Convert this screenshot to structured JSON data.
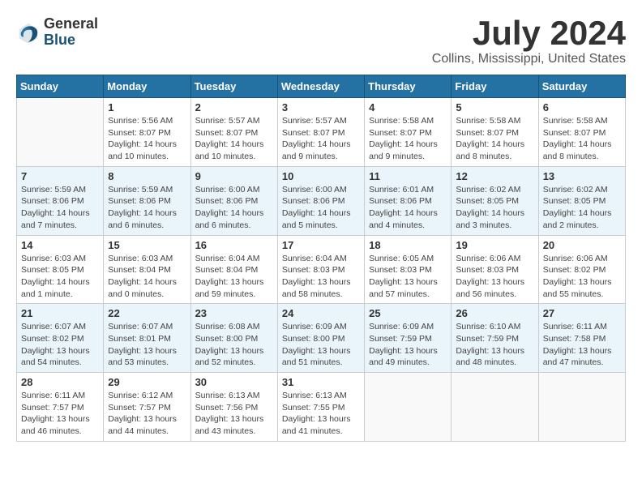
{
  "logo": {
    "general": "General",
    "blue": "Blue"
  },
  "title": "July 2024",
  "location": "Collins, Mississippi, United States",
  "days_of_week": [
    "Sunday",
    "Monday",
    "Tuesday",
    "Wednesday",
    "Thursday",
    "Friday",
    "Saturday"
  ],
  "weeks": [
    [
      {
        "day": "",
        "info": ""
      },
      {
        "day": "1",
        "info": "Sunrise: 5:56 AM\nSunset: 8:07 PM\nDaylight: 14 hours\nand 10 minutes."
      },
      {
        "day": "2",
        "info": "Sunrise: 5:57 AM\nSunset: 8:07 PM\nDaylight: 14 hours\nand 10 minutes."
      },
      {
        "day": "3",
        "info": "Sunrise: 5:57 AM\nSunset: 8:07 PM\nDaylight: 14 hours\nand 9 minutes."
      },
      {
        "day": "4",
        "info": "Sunrise: 5:58 AM\nSunset: 8:07 PM\nDaylight: 14 hours\nand 9 minutes."
      },
      {
        "day": "5",
        "info": "Sunrise: 5:58 AM\nSunset: 8:07 PM\nDaylight: 14 hours\nand 8 minutes."
      },
      {
        "day": "6",
        "info": "Sunrise: 5:58 AM\nSunset: 8:07 PM\nDaylight: 14 hours\nand 8 minutes."
      }
    ],
    [
      {
        "day": "7",
        "info": "Sunrise: 5:59 AM\nSunset: 8:06 PM\nDaylight: 14 hours\nand 7 minutes."
      },
      {
        "day": "8",
        "info": "Sunrise: 5:59 AM\nSunset: 8:06 PM\nDaylight: 14 hours\nand 6 minutes."
      },
      {
        "day": "9",
        "info": "Sunrise: 6:00 AM\nSunset: 8:06 PM\nDaylight: 14 hours\nand 6 minutes."
      },
      {
        "day": "10",
        "info": "Sunrise: 6:00 AM\nSunset: 8:06 PM\nDaylight: 14 hours\nand 5 minutes."
      },
      {
        "day": "11",
        "info": "Sunrise: 6:01 AM\nSunset: 8:06 PM\nDaylight: 14 hours\nand 4 minutes."
      },
      {
        "day": "12",
        "info": "Sunrise: 6:02 AM\nSunset: 8:05 PM\nDaylight: 14 hours\nand 3 minutes."
      },
      {
        "day": "13",
        "info": "Sunrise: 6:02 AM\nSunset: 8:05 PM\nDaylight: 14 hours\nand 2 minutes."
      }
    ],
    [
      {
        "day": "14",
        "info": "Sunrise: 6:03 AM\nSunset: 8:05 PM\nDaylight: 14 hours\nand 1 minute."
      },
      {
        "day": "15",
        "info": "Sunrise: 6:03 AM\nSunset: 8:04 PM\nDaylight: 14 hours\nand 0 minutes."
      },
      {
        "day": "16",
        "info": "Sunrise: 6:04 AM\nSunset: 8:04 PM\nDaylight: 13 hours\nand 59 minutes."
      },
      {
        "day": "17",
        "info": "Sunrise: 6:04 AM\nSunset: 8:03 PM\nDaylight: 13 hours\nand 58 minutes."
      },
      {
        "day": "18",
        "info": "Sunrise: 6:05 AM\nSunset: 8:03 PM\nDaylight: 13 hours\nand 57 minutes."
      },
      {
        "day": "19",
        "info": "Sunrise: 6:06 AM\nSunset: 8:03 PM\nDaylight: 13 hours\nand 56 minutes."
      },
      {
        "day": "20",
        "info": "Sunrise: 6:06 AM\nSunset: 8:02 PM\nDaylight: 13 hours\nand 55 minutes."
      }
    ],
    [
      {
        "day": "21",
        "info": "Sunrise: 6:07 AM\nSunset: 8:02 PM\nDaylight: 13 hours\nand 54 minutes."
      },
      {
        "day": "22",
        "info": "Sunrise: 6:07 AM\nSunset: 8:01 PM\nDaylight: 13 hours\nand 53 minutes."
      },
      {
        "day": "23",
        "info": "Sunrise: 6:08 AM\nSunset: 8:00 PM\nDaylight: 13 hours\nand 52 minutes."
      },
      {
        "day": "24",
        "info": "Sunrise: 6:09 AM\nSunset: 8:00 PM\nDaylight: 13 hours\nand 51 minutes."
      },
      {
        "day": "25",
        "info": "Sunrise: 6:09 AM\nSunset: 7:59 PM\nDaylight: 13 hours\nand 49 minutes."
      },
      {
        "day": "26",
        "info": "Sunrise: 6:10 AM\nSunset: 7:59 PM\nDaylight: 13 hours\nand 48 minutes."
      },
      {
        "day": "27",
        "info": "Sunrise: 6:11 AM\nSunset: 7:58 PM\nDaylight: 13 hours\nand 47 minutes."
      }
    ],
    [
      {
        "day": "28",
        "info": "Sunrise: 6:11 AM\nSunset: 7:57 PM\nDaylight: 13 hours\nand 46 minutes."
      },
      {
        "day": "29",
        "info": "Sunrise: 6:12 AM\nSunset: 7:57 PM\nDaylight: 13 hours\nand 44 minutes."
      },
      {
        "day": "30",
        "info": "Sunrise: 6:13 AM\nSunset: 7:56 PM\nDaylight: 13 hours\nand 43 minutes."
      },
      {
        "day": "31",
        "info": "Sunrise: 6:13 AM\nSunset: 7:55 PM\nDaylight: 13 hours\nand 41 minutes."
      },
      {
        "day": "",
        "info": ""
      },
      {
        "day": "",
        "info": ""
      },
      {
        "day": "",
        "info": ""
      }
    ]
  ]
}
